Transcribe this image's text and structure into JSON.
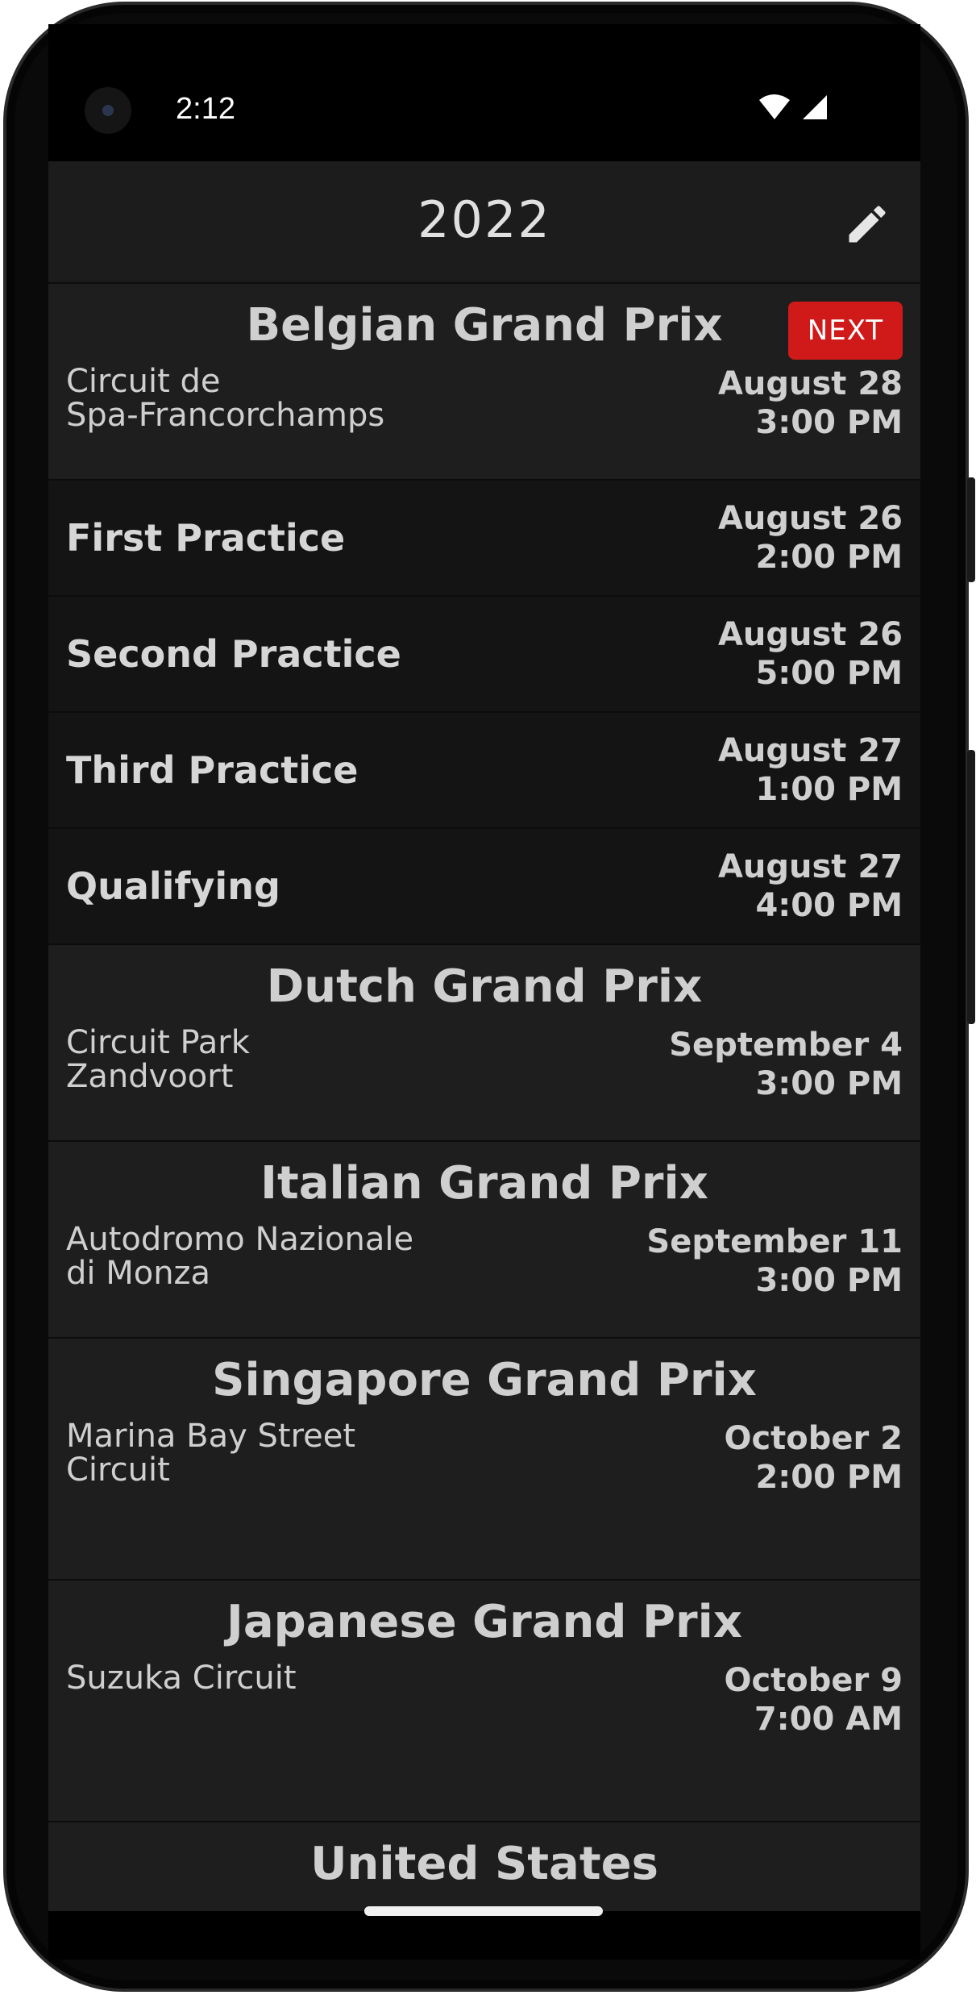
{
  "status_bar": {
    "time": "2:12",
    "icons": [
      "wifi-icon",
      "cellular-signal-icon"
    ]
  },
  "header": {
    "title": "2022",
    "edit_icon": "pencil-icon"
  },
  "races": [
    {
      "name": "Belgian Grand Prix",
      "badge": "NEXT",
      "circuit": "Circuit de\nSpa-Francorchamps",
      "date": "August 28",
      "time": "3:00 PM",
      "sessions": [
        {
          "name": "First Practice",
          "date": "August 26",
          "time": "2:00 PM"
        },
        {
          "name": "Second Practice",
          "date": "August 26",
          "time": "5:00 PM"
        },
        {
          "name": "Third Practice",
          "date": "August 27",
          "time": "1:00 PM"
        },
        {
          "name": "Qualifying",
          "date": "August 27",
          "time": "4:00 PM"
        }
      ]
    },
    {
      "name": "Dutch Grand Prix",
      "circuit": "Circuit Park\nZandvoort",
      "date": "September 4",
      "time": "3:00 PM"
    },
    {
      "name": "Italian Grand Prix",
      "circuit": "Autodromo Nazionale\ndi Monza",
      "date": "September 11",
      "time": "3:00 PM"
    },
    {
      "name": "Singapore Grand Prix",
      "circuit": "Marina Bay Street\nCircuit",
      "date": "October 2",
      "time": "2:00 PM"
    },
    {
      "name": "Japanese Grand Prix",
      "circuit": "Suzuka Circuit",
      "date": "October 9",
      "time": "7:00 AM"
    },
    {
      "name": "United States"
    }
  ],
  "colors": {
    "accent": "#d01a1a",
    "background": "#141414",
    "card": "#1e1e1e",
    "text": "#cfcfcf"
  }
}
